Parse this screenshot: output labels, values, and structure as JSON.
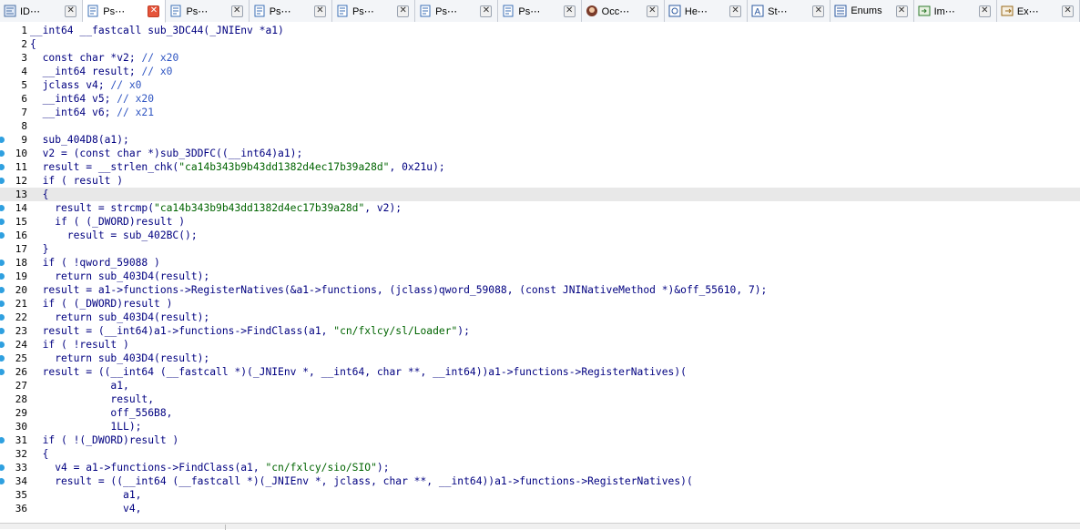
{
  "tabs": [
    {
      "label": "ID⋯",
      "icon": "ida-view-icon",
      "active": false
    },
    {
      "label": "Ps⋯",
      "icon": "pseudocode-icon",
      "active": true
    },
    {
      "label": "Ps⋯",
      "icon": "pseudocode-icon",
      "active": false
    },
    {
      "label": "Ps⋯",
      "icon": "pseudocode-icon",
      "active": false
    },
    {
      "label": "Ps⋯",
      "icon": "pseudocode-icon",
      "active": false
    },
    {
      "label": "Ps⋯",
      "icon": "pseudocode-icon",
      "active": false
    },
    {
      "label": "Ps⋯",
      "icon": "pseudocode-icon",
      "active": false
    },
    {
      "label": "Occ⋯",
      "icon": "occurrences-avatar-icon",
      "active": false
    },
    {
      "label": "He⋯",
      "icon": "hex-view-icon",
      "active": false
    },
    {
      "label": "St⋯",
      "icon": "structures-icon",
      "active": false
    },
    {
      "label": "Enums",
      "icon": "enums-icon",
      "active": false
    },
    {
      "label": "Im⋯",
      "icon": "imports-icon",
      "active": false
    },
    {
      "label": "Ex⋯",
      "icon": "exports-icon",
      "active": false
    }
  ],
  "tab_close_glyph": "✕",
  "code": {
    "highlighted_line": 13,
    "breakpoint_lines": [
      9,
      10,
      11,
      12,
      14,
      15,
      16,
      18,
      19,
      20,
      21,
      22,
      23,
      24,
      25,
      26,
      31,
      33,
      34
    ],
    "lines": [
      {
        "num": "1",
        "text": "__int64 __fastcall sub_3DC44(_JNIEnv *a1)"
      },
      {
        "num": "2",
        "text": "{"
      },
      {
        "num": "3",
        "text": "  const char *v2; // x20"
      },
      {
        "num": "4",
        "text": "  __int64 result; // x0"
      },
      {
        "num": "5",
        "text": "  jclass v4; // x0"
      },
      {
        "num": "6",
        "text": "  __int64 v5; // x20"
      },
      {
        "num": "7",
        "text": "  __int64 v6; // x21"
      },
      {
        "num": "8",
        "text": ""
      },
      {
        "num": "9",
        "text": "  sub_404D8(a1);"
      },
      {
        "num": "10",
        "text": "  v2 = (const char *)sub_3DDFC((__int64)a1);"
      },
      {
        "num": "11",
        "text": "  result = __strlen_chk(\"ca14b343b9b43dd1382d4ec17b39a28d\", 0x21u);"
      },
      {
        "num": "12",
        "text": "  if ( result )"
      },
      {
        "num": "13",
        "text": "  {"
      },
      {
        "num": "14",
        "text": "    result = strcmp(\"ca14b343b9b43dd1382d4ec17b39a28d\", v2);"
      },
      {
        "num": "15",
        "text": "    if ( (_DWORD)result )"
      },
      {
        "num": "16",
        "text": "      result = sub_402BC();"
      },
      {
        "num": "17",
        "text": "  }"
      },
      {
        "num": "18",
        "text": "  if ( !qword_59088 )"
      },
      {
        "num": "19",
        "text": "    return sub_403D4(result);"
      },
      {
        "num": "20",
        "text": "  result = a1->functions->RegisterNatives(&a1->functions, (jclass)qword_59088, (const JNINativeMethod *)&off_55610, 7);"
      },
      {
        "num": "21",
        "text": "  if ( (_DWORD)result )"
      },
      {
        "num": "22",
        "text": "    return sub_403D4(result);"
      },
      {
        "num": "23",
        "text": "  result = (__int64)a1->functions->FindClass(a1, \"cn/fxlcy/sl/Loader\");"
      },
      {
        "num": "24",
        "text": "  if ( !result )"
      },
      {
        "num": "25",
        "text": "    return sub_403D4(result);"
      },
      {
        "num": "26",
        "text": "  result = ((__int64 (__fastcall *)(_JNIEnv *, __int64, char **, __int64))a1->functions->RegisterNatives)("
      },
      {
        "num": "27",
        "text": "             a1,"
      },
      {
        "num": "28",
        "text": "             result,"
      },
      {
        "num": "29",
        "text": "             off_556B8,"
      },
      {
        "num": "30",
        "text": "             1LL);"
      },
      {
        "num": "31",
        "text": "  if ( !(_DWORD)result )"
      },
      {
        "num": "32",
        "text": "  {"
      },
      {
        "num": "33",
        "text": "    v4 = a1->functions->FindClass(a1, \"cn/fxlcy/sio/SIO\");"
      },
      {
        "num": "34",
        "text": "    result = ((__int64 (__fastcall *)(_JNIEnv *, jclass, char **, __int64))a1->functions->RegisterNatives)("
      },
      {
        "num": "35",
        "text": "               a1,"
      },
      {
        "num": "36",
        "text": "               v4,"
      }
    ]
  },
  "colors": {
    "keyword": "#000080",
    "comment": "#2f55c2",
    "string": "#006400",
    "breakpoint": "#2fa0e0",
    "active_tab_close": "#e5543a",
    "highlight_line": "#e8e8e8"
  }
}
